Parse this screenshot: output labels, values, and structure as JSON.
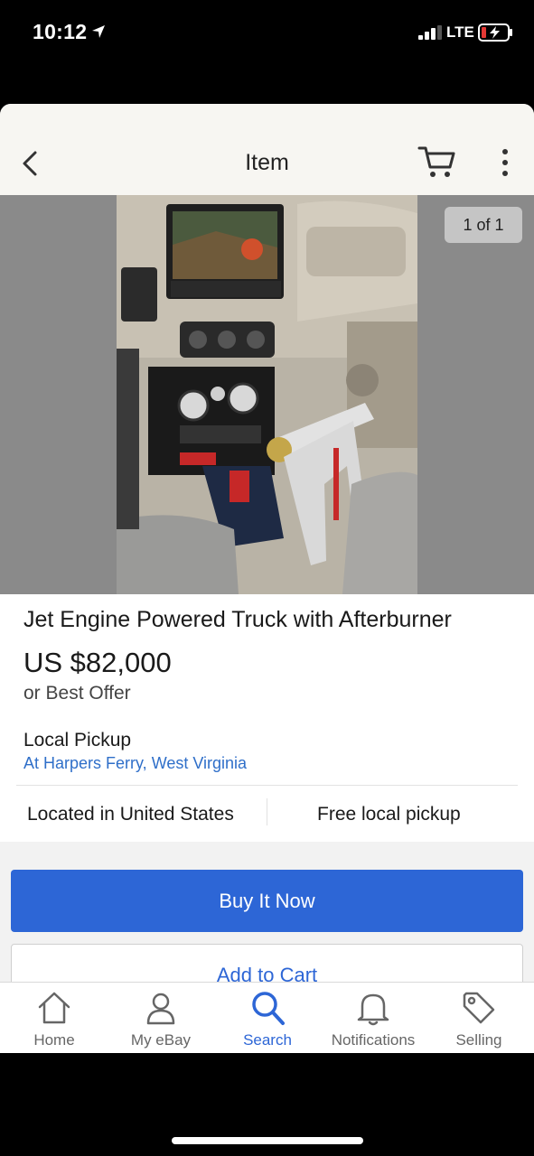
{
  "status_bar": {
    "time": "10:12",
    "network": "LTE"
  },
  "nav": {
    "title": "Item",
    "icons": [
      "back-chevron-icon",
      "cart-icon",
      "more-vertical-icon"
    ]
  },
  "gallery": {
    "counter": "1 of 1"
  },
  "listing": {
    "title": "Jet Engine Powered Truck with Afterburner",
    "price": "US $82,000",
    "best_offer": "or Best Offer",
    "pickup_label": "Local Pickup",
    "pickup_location": "At Harpers Ferry, West Virginia",
    "located_in": "Located in United States",
    "shipping": "Free local pickup"
  },
  "actions": {
    "buy_now": "Buy It Now",
    "add_to_cart": "Add to Cart"
  },
  "tabbar": {
    "tabs": [
      {
        "label": "Home",
        "icon": "home-icon"
      },
      {
        "label": "My eBay",
        "icon": "person-icon"
      },
      {
        "label": "Search",
        "icon": "search-icon"
      },
      {
        "label": "Notifications",
        "icon": "bell-icon"
      },
      {
        "label": "Selling",
        "icon": "tag-icon"
      }
    ],
    "active": "Search"
  },
  "colors": {
    "accent": "#2d66d6",
    "link": "#2f6fc9",
    "nav_bg": "#f7f6f2"
  }
}
